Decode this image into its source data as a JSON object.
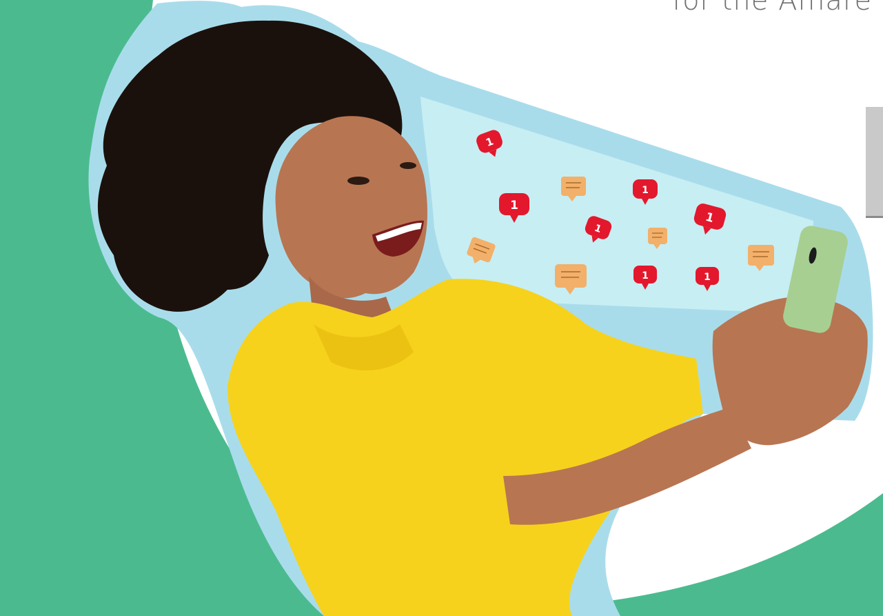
{
  "headline": {
    "fragment": "for the Amare"
  },
  "colors": {
    "brand_green": "#4bbb8f",
    "backdrop_blue": "#a9dceb",
    "beam_aqua": "#c7eef3",
    "shirt_yellow": "#f6d21c",
    "skin": "#b87552",
    "hair": "#1b110c",
    "phone_green": "#a7cf92",
    "notification_red": "#e3182d",
    "comment_orange": "#f2b06a",
    "text_gray": "#6f6f6f"
  },
  "icons": {
    "like": "heart-notification-icon",
    "comment": "comment-bubble-icon"
  },
  "notifications": {
    "like_count": "1"
  }
}
